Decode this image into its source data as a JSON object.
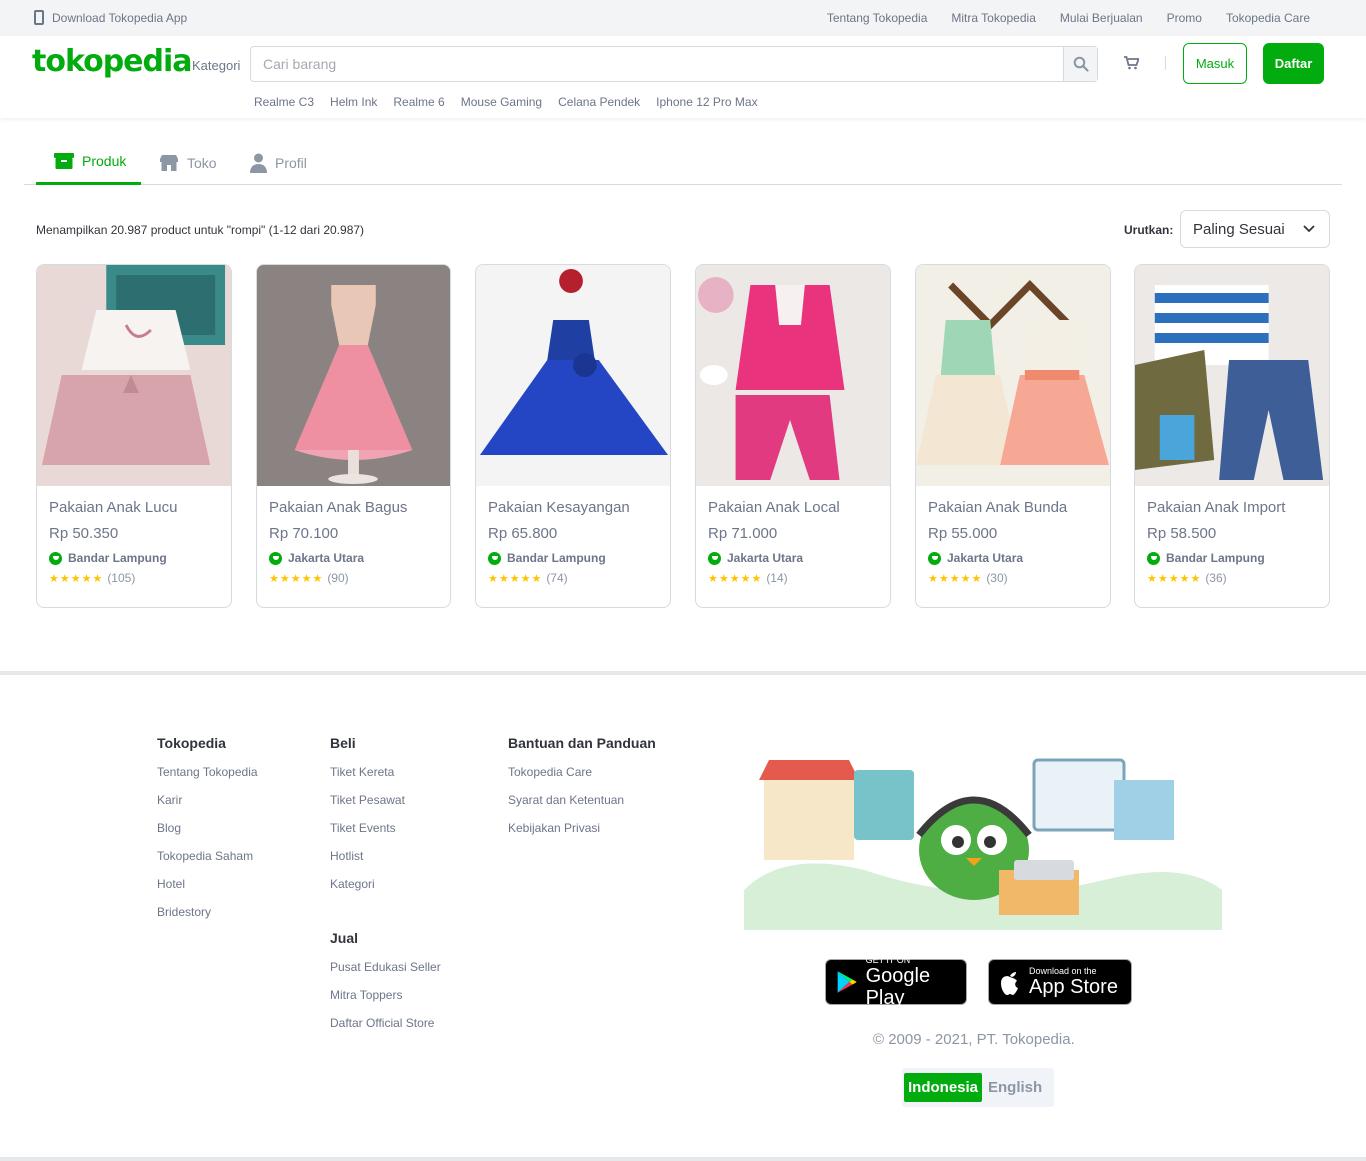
{
  "topbar": {
    "download_label": "Download Tokopedia App",
    "links": [
      "Tentang Tokopedia",
      "Mitra Tokopedia",
      "Mulai Berjualan",
      "Promo",
      "Tokopedia Care"
    ]
  },
  "header": {
    "logo": "tokopedia",
    "kategori": "Kategori",
    "search_placeholder": "Cari barang",
    "login_label": "Masuk",
    "register_label": "Daftar",
    "keywords": [
      "Realme C3",
      "Helm Ink",
      "Realme 6",
      "Mouse Gaming",
      "Celana Pendek",
      "Iphone 12 Pro Max"
    ]
  },
  "tabs": [
    {
      "label": "Produk",
      "icon": "product-box-icon",
      "active": true
    },
    {
      "label": "Toko",
      "icon": "shop-icon",
      "active": false
    },
    {
      "label": "Profil",
      "icon": "user-icon",
      "active": false
    }
  ],
  "results": {
    "info": "Menampilkan 20.987 product untuk \"rompi\" (1-12 dari 20.987)",
    "sort_label": "Urutkan:",
    "sort_value": "Paling Sesuai"
  },
  "products": [
    {
      "name": "Pakaian Anak Lucu",
      "price": "Rp 50.350",
      "location": "Bandar Lampung",
      "reviews": "(105)",
      "rating": 5
    },
    {
      "name": "Pakaian Anak Bagus",
      "price": "Rp 70.100",
      "location": "Jakarta Utara",
      "reviews": "(90)",
      "rating": 5
    },
    {
      "name": "Pakaian Kesayangan",
      "price": "Rp 65.800",
      "location": "Bandar Lampung",
      "reviews": "(74)",
      "rating": 5
    },
    {
      "name": "Pakaian Anak Local",
      "price": "Rp 71.000",
      "location": "Jakarta Utara",
      "reviews": "(14)",
      "rating": 5
    },
    {
      "name": "Pakaian Anak Bunda",
      "price": "Rp 55.000",
      "location": "Jakarta Utara",
      "reviews": "(30)",
      "rating": 5
    },
    {
      "name": "Pakaian Anak Import",
      "price": "Rp 58.500",
      "location": "Bandar Lampung",
      "reviews": "(36)",
      "rating": 5
    }
  ],
  "stars_text": "★★★★★",
  "footer": {
    "col1": {
      "title": "Tokopedia",
      "links": [
        "Tentang Tokopedia",
        "Karir",
        "Blog",
        "Tokopedia Saham",
        "Hotel",
        "Bridestory"
      ]
    },
    "col2": {
      "title": "Beli",
      "links": [
        "Tiket Kereta",
        "Tiket Pesawat",
        "Tiket Events",
        "Hotlist",
        "Kategori"
      ]
    },
    "col2b": {
      "title": "Jual",
      "links": [
        "Pusat Edukasi Seller",
        "Mitra Toppers",
        "Daftar Official Store"
      ]
    },
    "col3": {
      "title": "Bantuan dan Panduan",
      "links": [
        "Tokopedia Care",
        "Syarat dan Ketentuan",
        "Kebijakan Privasi"
      ]
    },
    "google_play_small": "GET IT ON",
    "google_play_big": "Google Play",
    "app_store_small": "Download on the",
    "app_store_big": "App Store",
    "copyright": "© 2009 - 2021, PT. Tokopedia.",
    "lang_on": "Indonesia",
    "lang_off": "English"
  },
  "colors": {
    "brand": "#03ac0e",
    "text": "#31353b",
    "muted": "#6d7588",
    "star": "#ffc400"
  }
}
